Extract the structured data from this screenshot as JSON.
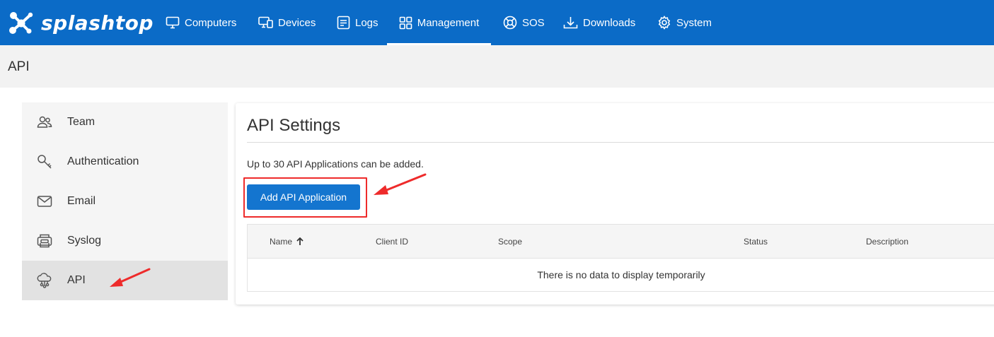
{
  "app": {
    "brand": "splashtop"
  },
  "nav": {
    "items": [
      {
        "label": "Computers",
        "icon": "monitor-icon"
      },
      {
        "label": "Devices",
        "icon": "devices-icon"
      },
      {
        "label": "Logs",
        "icon": "logs-icon"
      },
      {
        "label": "Management",
        "icon": "grid-icon",
        "active": true
      },
      {
        "label": "SOS",
        "icon": "lifebuoy-icon"
      },
      {
        "label": "Downloads",
        "icon": "download-icon"
      },
      {
        "label": "System",
        "icon": "gear-icon"
      }
    ]
  },
  "page": {
    "title": "API"
  },
  "sidebar": {
    "items": [
      {
        "label": "Team",
        "icon": "team-icon"
      },
      {
        "label": "Authentication",
        "icon": "key-icon"
      },
      {
        "label": "Email",
        "icon": "mail-icon"
      },
      {
        "label": "Syslog",
        "icon": "syslog-icon"
      },
      {
        "label": "API",
        "icon": "api-icon",
        "active": true
      }
    ]
  },
  "main": {
    "title": "API Settings",
    "note": "Up to 30 API Applications can be added.",
    "add_button_label": "Add API Application",
    "table": {
      "columns": [
        "Name",
        "Client ID",
        "Scope",
        "Status",
        "Description"
      ],
      "sort_column": "Name",
      "empty_text": "There is no data to display temporarily"
    }
  },
  "colors": {
    "topbar": "#0b6bc7",
    "button": "#1475cf",
    "annotation": "#ee2b2b"
  }
}
